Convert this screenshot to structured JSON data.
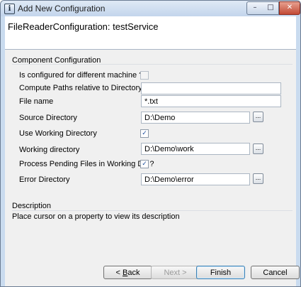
{
  "window": {
    "title": "Add New Configuration",
    "icon_name": "app-config-icon",
    "controls": {
      "minimize": "minimize-icon",
      "maximize": "maximize-icon",
      "close": "close-icon"
    }
  },
  "header": {
    "title": "FileReaderConfiguration: testService"
  },
  "component": {
    "group_title": "Component Configuration",
    "fields": [
      {
        "label": "Is configured for different machine ?",
        "type": "checkbox",
        "checked": false,
        "disabled": true
      },
      {
        "label": "Compute Paths relative to Directory:",
        "type": "text",
        "value": ""
      },
      {
        "label": "File name",
        "type": "text",
        "value": "*.txt"
      },
      {
        "label": "Source Directory",
        "type": "path",
        "value": "D:\\Demo",
        "browse": "..."
      },
      {
        "label": "Use Working Directory",
        "type": "checkbox",
        "checked": true,
        "mark": "✓"
      },
      {
        "label": "Working directory",
        "type": "path",
        "value": "D:\\Demo\\work",
        "browse": "..."
      },
      {
        "label": "Process Pending Files in Working Dir ?",
        "type": "checkbox",
        "checked": true,
        "mark": "✓"
      },
      {
        "label": "Error Directory",
        "type": "path",
        "value": "D:\\Demo\\error",
        "browse": "..."
      }
    ]
  },
  "description": {
    "title": "Description",
    "text": "Place cursor on a property to view its description"
  },
  "footer": {
    "back": {
      "mnemonic": "B",
      "rest": "ack",
      "prefix": "< "
    },
    "next": {
      "text": "Next >"
    },
    "finish": "Finish",
    "cancel": "Cancel"
  },
  "colors": {
    "title_bar": "#c9dbef",
    "panel": "#f0f0f0",
    "accent_border": "#3c7fb1"
  }
}
